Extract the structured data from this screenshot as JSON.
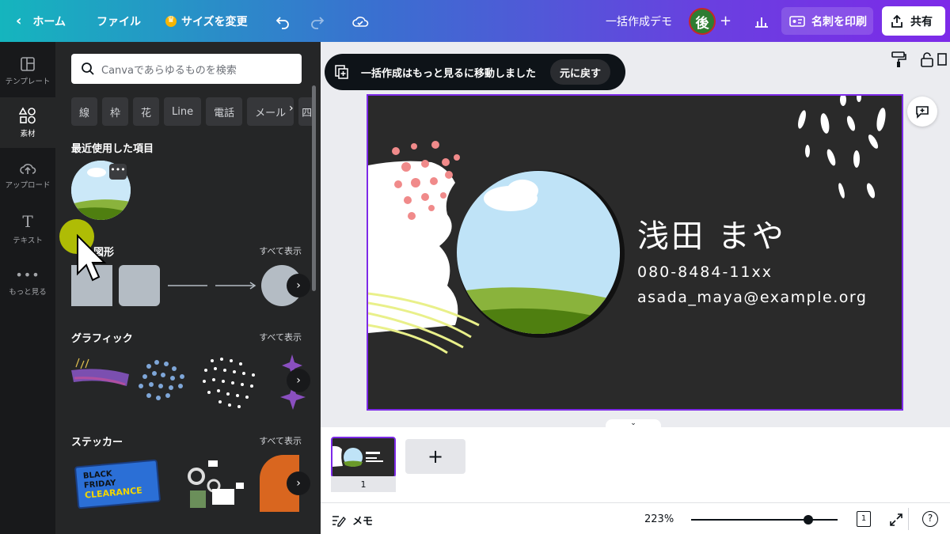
{
  "topbar": {
    "home": "ホーム",
    "file": "ファイル",
    "resize": "サイズを変更",
    "title": "一括作成デモ",
    "avatar": "後",
    "print": "名刺を印刷",
    "share": "共有"
  },
  "rail": {
    "items": [
      {
        "label": "テンプレート",
        "icon": "template-icon"
      },
      {
        "label": "素材",
        "icon": "elements-icon"
      },
      {
        "label": "アップロード",
        "icon": "upload-icon"
      },
      {
        "label": "テキスト",
        "icon": "text-icon"
      },
      {
        "label": "もっと見る",
        "icon": "more-icon"
      }
    ]
  },
  "panel": {
    "search_placeholder": "Canvaであらゆるものを検索",
    "chips": [
      "線",
      "枠",
      "花",
      "Line",
      "電話",
      "メール",
      "四"
    ],
    "recent_title": "最近使用した項目",
    "shapes_title": "図形",
    "graphics_title": "グラフィック",
    "stickers_title": "ステッカー",
    "see_all": "すべて表示",
    "sticker_black_friday": [
      "BLACK",
      "FRIDAY",
      "CLEARANCE"
    ]
  },
  "toast": {
    "message": "一括作成はもっと見るに移動しました",
    "undo": "元に戻す"
  },
  "card": {
    "name": "浅田 まや",
    "phone": "080-8484-11xx",
    "email": "asada_maya@example.org"
  },
  "pages": {
    "page_number": "1"
  },
  "statusbar": {
    "notes": "メモ",
    "zoom": "223%",
    "zoom_fraction": 0.8,
    "page_count": "1",
    "help": "?"
  }
}
